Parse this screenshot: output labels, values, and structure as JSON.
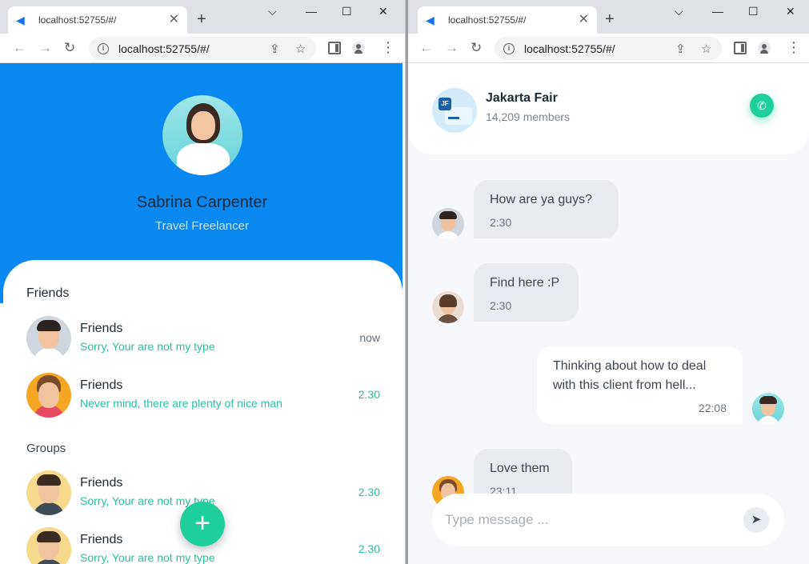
{
  "browser_left": {
    "tab_title": "localhost:52755/#/",
    "tab_close": "✕",
    "new_tab": "+",
    "url": "localhost:52755/#/",
    "controls": {
      "minimize": "⌵",
      "restore": "—",
      "maximize": "☐",
      "close": "✕"
    }
  },
  "browser_right": {
    "tab_title": "localhost:52755/#/",
    "tab_close": "✕",
    "new_tab": "+",
    "url": "localhost:52755/#/",
    "controls": {
      "minimize": "⌵",
      "restore": "—",
      "maximize": "☐",
      "close": "✕"
    }
  },
  "profile": {
    "name": "Sabrina Carpenter",
    "role": "Travel Freelancer"
  },
  "friends_section": {
    "title": "Friends",
    "items": [
      {
        "name": "Friends",
        "message": "Sorry, Your are not my type",
        "time": "now"
      },
      {
        "name": "Friends",
        "message": "Never mind, there are plenty of nice man",
        "time": "2.30"
      }
    ]
  },
  "groups_section": {
    "title": "Groups",
    "items": [
      {
        "name": "Friends",
        "message": "Sorry, Your are not my type",
        "time": "2.30"
      },
      {
        "name": "Friends",
        "message": "Sorry, Your are not my type",
        "time": "2.30"
      }
    ]
  },
  "fab": {
    "label": "+"
  },
  "chat": {
    "group_badge": "JF",
    "group_name": "Jakarta Fair",
    "members": "14,209 members",
    "messages": [
      {
        "text": "How are ya guys?",
        "time": "2:30",
        "side": "left"
      },
      {
        "text": "Find here :P",
        "time": "2:30",
        "side": "left"
      },
      {
        "text": "Thinking about how to deal with this client from hell...",
        "time": "22:08",
        "side": "right"
      },
      {
        "text": "Love them",
        "time": "23:11",
        "side": "left"
      }
    ],
    "compose_placeholder": "Type message ..."
  },
  "icons": {
    "back": "←",
    "forward": "→",
    "reload": "↻",
    "info": "i",
    "share": "⇪",
    "star": "☆",
    "menu": "⋮",
    "call": "✆",
    "send": "➤"
  },
  "colors": {
    "hero_blue": "#0988F2",
    "accent_green": "#1ECF9C",
    "message_green": "#28C2A0",
    "chat_bg": "#F6F8FB",
    "left_bubble": "#E8ECF0"
  }
}
